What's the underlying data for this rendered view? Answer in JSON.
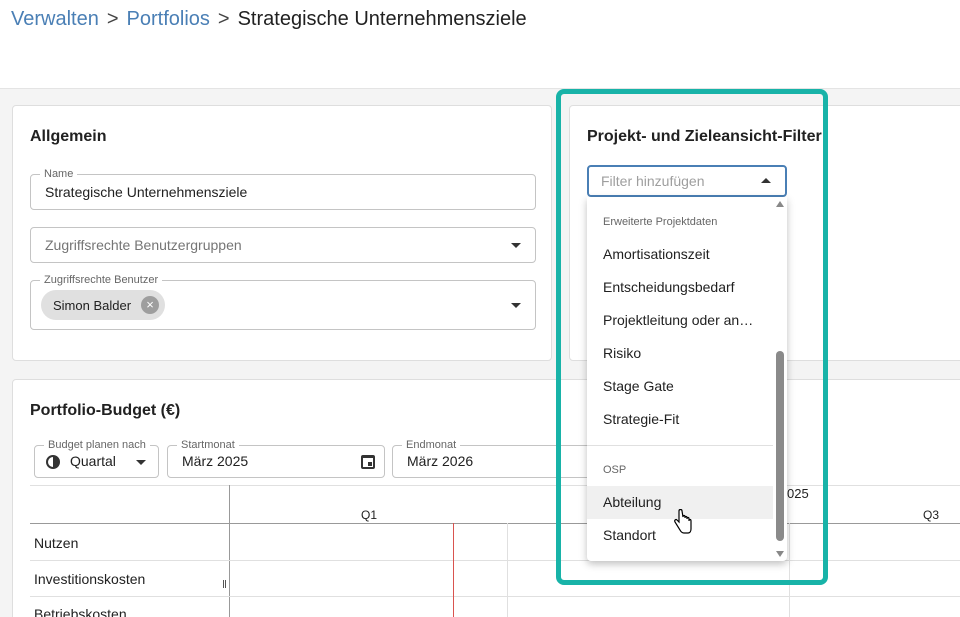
{
  "breadcrumb": {
    "items": [
      "Verwalten",
      "Portfolios"
    ],
    "separator": ">",
    "current": "Strategische Unternehmensziele"
  },
  "general": {
    "title": "Allgemein",
    "name_label": "Name",
    "name_value": "Strategische Unternehmensziele",
    "groups_placeholder": "Zugriffsrechte Benutzergruppen",
    "users_label": "Zugriffsrechte Benutzer",
    "user_chip": "Simon Balder"
  },
  "filter": {
    "title": "Projekt- und Zieleansicht-Filter",
    "placeholder": "Filter hinzufügen",
    "groups": [
      {
        "label": "Erweiterte Projektdaten",
        "items": [
          "Amortisationszeit",
          "Entscheidungsbedarf",
          "Projektleitung oder an…",
          "Risiko",
          "Stage Gate",
          "Strategie-Fit"
        ]
      },
      {
        "label": "OSP",
        "items": [
          "Abteilung",
          "Standort"
        ]
      }
    ],
    "hovered_item": "Abteilung"
  },
  "budget": {
    "title": "Portfolio-Budget (€)",
    "plan_label": "Budget planen nach",
    "plan_value": "Quartal",
    "start_label": "Startmonat",
    "start_value": "März 2025",
    "end_label": "Endmonat",
    "end_value": "März 2026",
    "year_fragment": "025",
    "quarters": [
      "Q1",
      "Q3"
    ],
    "rows": [
      "Nutzen",
      "Investitionskosten",
      "Betriebskosten"
    ]
  },
  "colors": {
    "highlight": "#18b3a8",
    "link": "#4a7fb5",
    "today_line": "#d9534f"
  }
}
